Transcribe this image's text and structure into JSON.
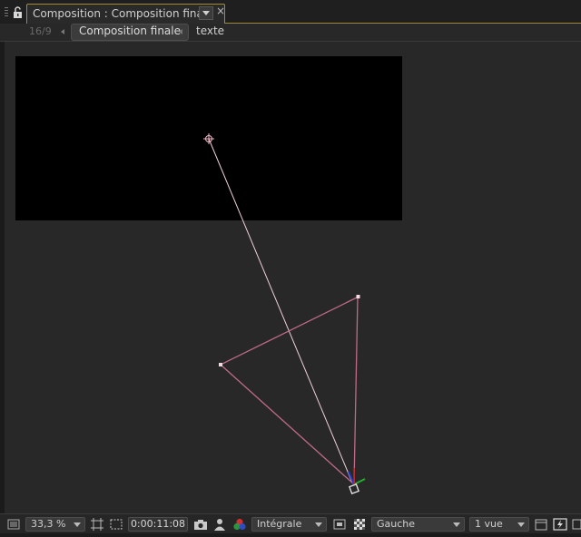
{
  "panel": {
    "tab_title": "Composition : Composition finale",
    "close_glyph": "×"
  },
  "breadcrumb": {
    "aspect": "16/9",
    "active": "Composition finale",
    "next": "texte"
  },
  "toolbar": {
    "zoom": "33,3 %",
    "timecode": "0:00:11:08",
    "resolution": "Intégrale",
    "view_layout": "Gauche",
    "views": "1 vue"
  },
  "colors": {
    "panel_accent": "#a08a3a",
    "path_line": "#c06a8a",
    "aim_line": "#f0d0d8",
    "comp_background": "#000000",
    "viewer_background": "#282828"
  },
  "icons": [
    "lock-icon",
    "panel-menu-icon",
    "close-icon",
    "grid-icon",
    "mask-icon",
    "camera-icon",
    "person-icon",
    "channels-icon",
    "region-icon",
    "transparency-grid-icon",
    "render-icon",
    "fast-preview-icon",
    "flowchart-icon"
  ]
}
